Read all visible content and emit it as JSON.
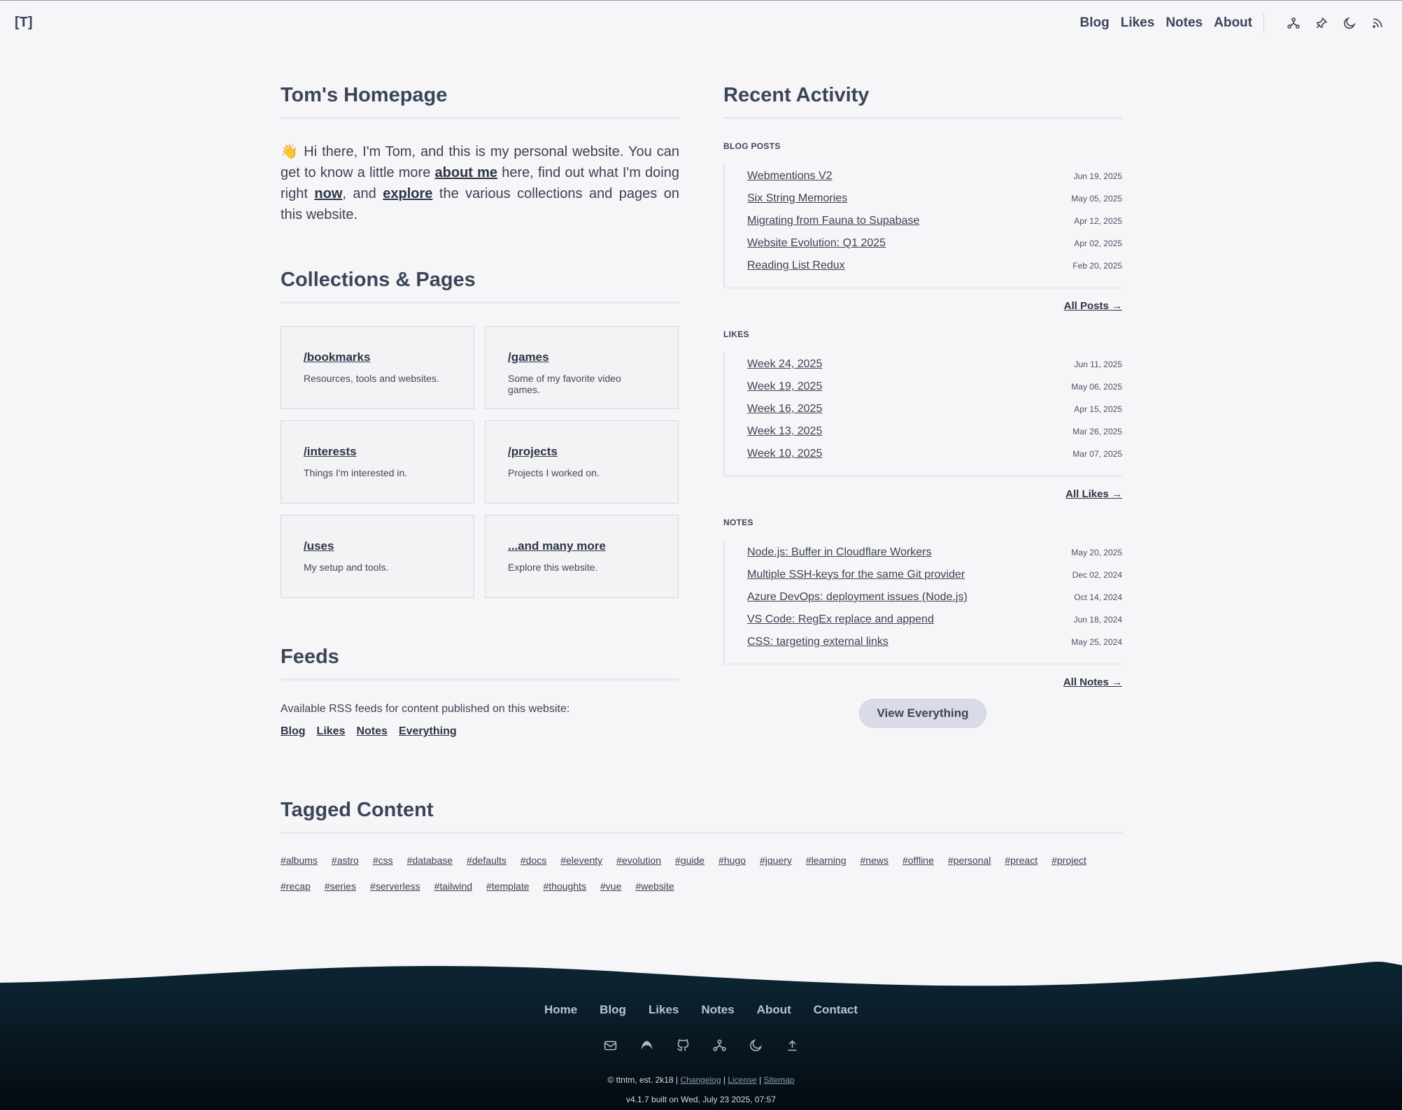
{
  "header": {
    "logo": "[T]",
    "nav": [
      "Blog",
      "Likes",
      "Notes",
      "About"
    ],
    "icons": [
      "network-icon",
      "pin-icon",
      "moon-icon",
      "rss-icon"
    ]
  },
  "home": {
    "title": "Tom's Homepage",
    "intro_pre": "👋 Hi there, I'm Tom, and this is my personal website. You can get to know a little more ",
    "intro_link1": "about me",
    "intro_mid1": " here, find out what I'm doing right ",
    "intro_link2": "now",
    "intro_mid2": ", and ",
    "intro_link3": "explore",
    "intro_post": " the various collections and pages on this website."
  },
  "collections": {
    "title": "Collections & Pages",
    "cards": [
      {
        "title": "/bookmarks",
        "desc": "Resources, tools and websites."
      },
      {
        "title": "/games",
        "desc": "Some of my favorite video games."
      },
      {
        "title": "/interests",
        "desc": "Things I'm interested in."
      },
      {
        "title": "/projects",
        "desc": "Projects I worked on."
      },
      {
        "title": "/uses",
        "desc": "My setup and tools."
      },
      {
        "title": "...and many more",
        "desc": "Explore this website."
      }
    ]
  },
  "feeds": {
    "title": "Feeds",
    "text": "Available RSS feeds for content published on this website:",
    "links": [
      "Blog",
      "Likes",
      "Notes",
      "Everything"
    ]
  },
  "activity": {
    "title": "Recent Activity",
    "blog": {
      "label": "BLOG POSTS",
      "items": [
        {
          "title": "Webmentions V2",
          "date": "Jun 19, 2025"
        },
        {
          "title": "Six String Memories",
          "date": "May 05, 2025"
        },
        {
          "title": "Migrating from Fauna to Supabase",
          "date": "Apr 12, 2025"
        },
        {
          "title": "Website Evolution: Q1 2025",
          "date": "Apr 02, 2025"
        },
        {
          "title": "Reading List Redux",
          "date": "Feb 20, 2025"
        }
      ],
      "all": "All Posts →"
    },
    "likes": {
      "label": "LIKES",
      "items": [
        {
          "title": "Week 24, 2025",
          "date": "Jun 11, 2025"
        },
        {
          "title": "Week 19, 2025",
          "date": "May 06, 2025"
        },
        {
          "title": "Week 16, 2025",
          "date": "Apr 15, 2025"
        },
        {
          "title": "Week 13, 2025",
          "date": "Mar 26, 2025"
        },
        {
          "title": "Week 10, 2025",
          "date": "Mar 07, 2025"
        }
      ],
      "all": "All Likes →"
    },
    "notes": {
      "label": "NOTES",
      "items": [
        {
          "title": "Node.js: Buffer in Cloudflare Workers",
          "date": "May 20, 2025"
        },
        {
          "title": "Multiple SSH-keys for the same Git provider",
          "date": "Dec 02, 2024"
        },
        {
          "title": "Azure DevOps: deployment issues (Node.js)",
          "date": "Oct 14, 2024"
        },
        {
          "title": "VS Code: RegEx replace and append",
          "date": "Jun 18, 2024"
        },
        {
          "title": "CSS: targeting external links",
          "date": "May 25, 2024"
        }
      ],
      "all": "All Notes →"
    },
    "view_all": "View Everything"
  },
  "tagged": {
    "title": "Tagged Content",
    "tags": [
      "#albums",
      "#astro",
      "#css",
      "#database",
      "#defaults",
      "#docs",
      "#eleventy",
      "#evolution",
      "#guide",
      "#hugo",
      "#jquery",
      "#learning",
      "#news",
      "#offline",
      "#personal",
      "#preact",
      "#project",
      "#recap",
      "#series",
      "#serverless",
      "#tailwind",
      "#template",
      "#thoughts",
      "#vue",
      "#website"
    ]
  },
  "footer": {
    "nav": [
      "Home",
      "Blog",
      "Likes",
      "Notes",
      "About",
      "Contact"
    ],
    "icons": [
      "mail-icon",
      "mastodon-icon",
      "github-icon",
      "network-icon",
      "moon-icon",
      "upload-icon"
    ],
    "copy": "© ttntm, est. 2k18 |",
    "changelog": "Changelog",
    "license": "License",
    "sitemap": "Sitemap",
    "sep": "|",
    "build": "v4.1.7 built on Wed, July 23 2025, 07:57"
  },
  "colors": {
    "background": "#f6f6f9",
    "text": "#3b4558",
    "footer": "#0c2330"
  }
}
